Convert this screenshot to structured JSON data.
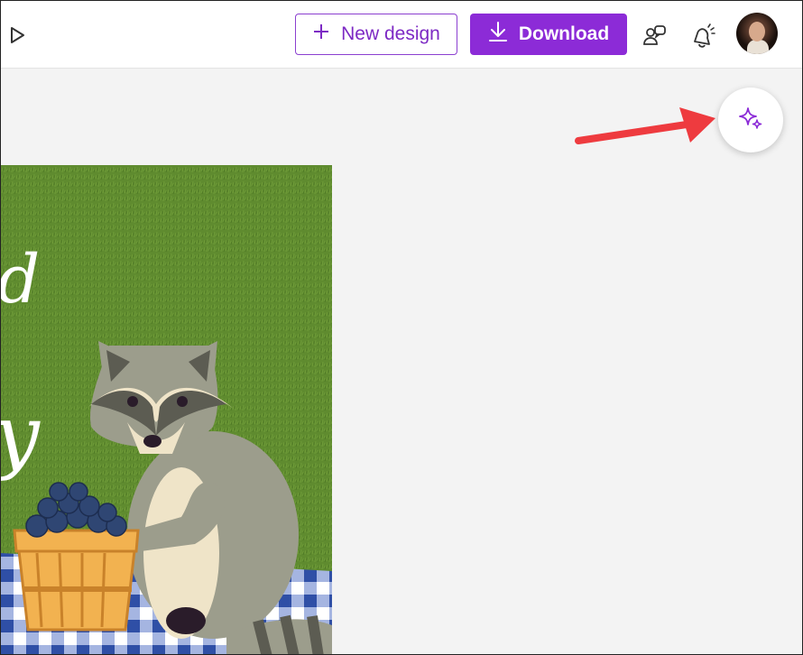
{
  "toolbar": {
    "play_icon": "play-icon",
    "new_design_label": "New design",
    "download_label": "Download",
    "comments_icon": "comments-icon",
    "notifications_icon": "notifications-icon",
    "avatar_icon": "profile-avatar"
  },
  "canvas": {
    "visible_text_fragments": [
      "d",
      "y"
    ]
  },
  "magic_button": {
    "icon": "sparkle-icon"
  },
  "colors": {
    "brand_purple": "#8c2bd7",
    "annotation_arrow": "#ee3b3f",
    "grass": "#5d8a2e"
  }
}
